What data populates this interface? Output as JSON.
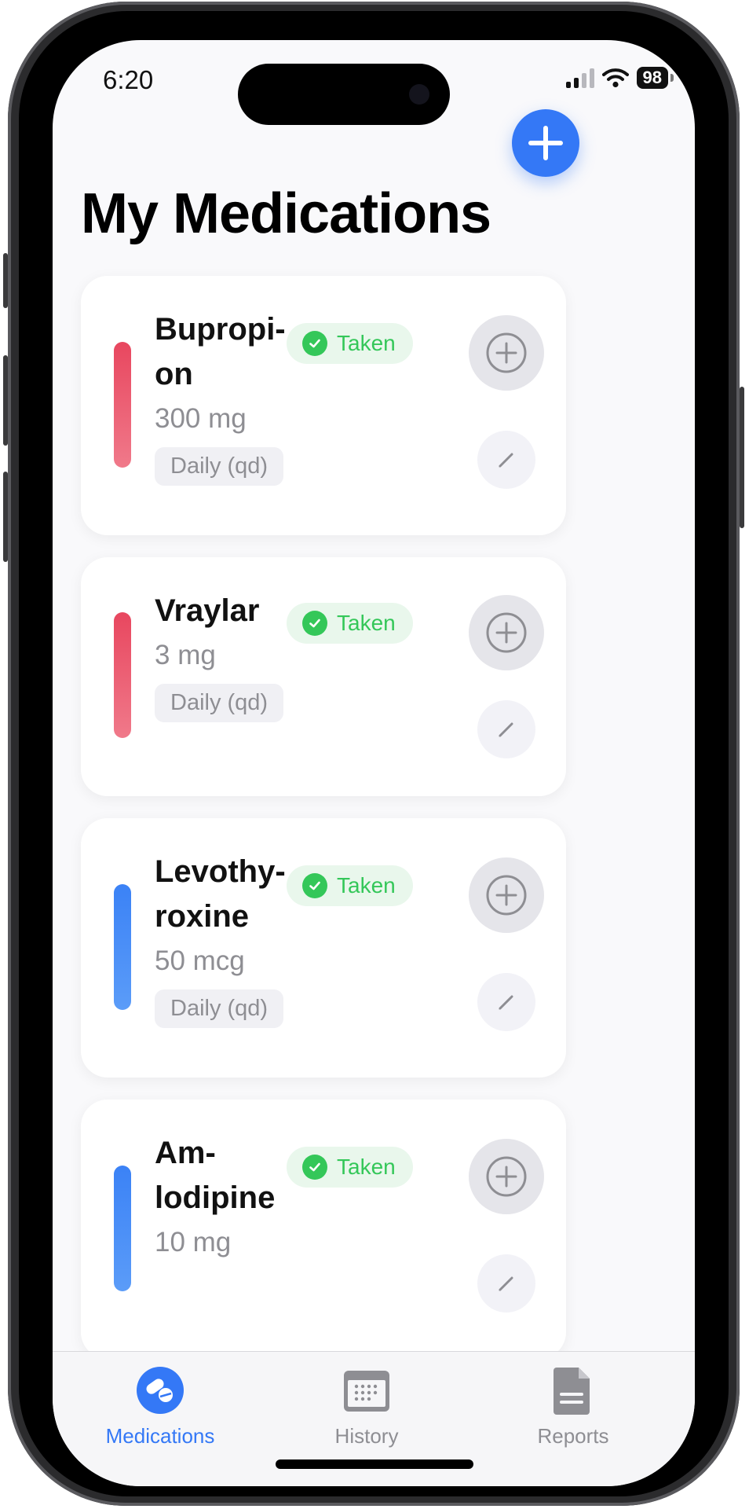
{
  "status_bar": {
    "time": "6:20",
    "battery": "98"
  },
  "header": {
    "title": "My Medications"
  },
  "medications": [
    {
      "name": "Bupropi-on",
      "name_lines": [
        "Bupropi-",
        "on"
      ],
      "dose": "300 mg",
      "frequency": "Daily (qd)",
      "status": "Taken",
      "color": "#e8475f"
    },
    {
      "name": "Vraylar",
      "name_lines": [
        "Vraylar"
      ],
      "dose": "3 mg",
      "frequency": "Daily (qd)",
      "status": "Taken",
      "color": "#e8475f"
    },
    {
      "name": "Levothy-roxine",
      "name_lines": [
        "Levothy-",
        "roxine"
      ],
      "dose": "50 mcg",
      "frequency": "Daily (qd)",
      "status": "Taken",
      "color": "#3b82f6"
    },
    {
      "name": "Am-lodipine",
      "name_lines": [
        "Am-",
        "lodipine"
      ],
      "dose": "10 mg",
      "status": "Taken",
      "color": "#3b82f6"
    }
  ],
  "tabs": [
    {
      "label": "Medications",
      "icon": "pills-icon",
      "active": true
    },
    {
      "label": "History",
      "icon": "calendar-icon",
      "active": false
    },
    {
      "label": "Reports",
      "icon": "document-icon",
      "active": false
    }
  ],
  "colors": {
    "accent": "#3478f6",
    "taken": "#34c759"
  }
}
